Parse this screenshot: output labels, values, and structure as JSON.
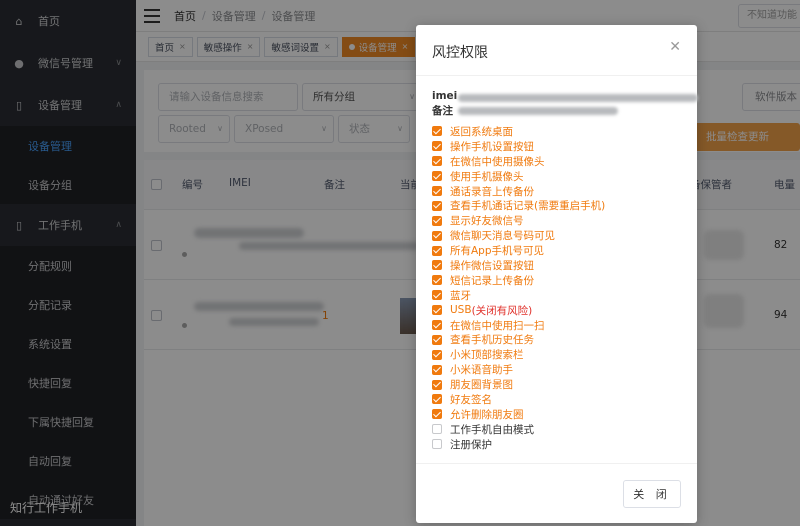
{
  "sidebar": {
    "items": [
      {
        "label": "首页",
        "icon": "home-icon"
      },
      {
        "label": "微信号管理",
        "icon": "wechat-icon"
      },
      {
        "label": "设备管理",
        "icon": "phone-icon"
      },
      {
        "label": "工作手机",
        "icon": "phone-icon"
      }
    ],
    "device_sub": [
      "设备管理",
      "设备分组"
    ],
    "work_sub": [
      "分配规则",
      "分配记录",
      "系统设置",
      "快捷回复",
      "下属快捷回复",
      "自动回复",
      "自动通过好友"
    ],
    "footer": "知行工作手机"
  },
  "topbar": {
    "crumbs": [
      "首页",
      "设备管理",
      "设备管理"
    ],
    "right_box": "不知道功能"
  },
  "tabs": [
    {
      "label": "首页"
    },
    {
      "label": "敏感操作"
    },
    {
      "label": "敏感词设置"
    },
    {
      "label": "设备管理"
    }
  ],
  "filters": {
    "search_placeholder": "请输入设备信息搜索",
    "group_select": "所有分组",
    "rooted": "Rooted",
    "xposed": "XPosed",
    "status": "状态",
    "software_version": "软件版本",
    "batch_button": "批量检查更新"
  },
  "table": {
    "headers": {
      "no": "编号",
      "imei": "IMEI",
      "remark": "备注",
      "current": "当前",
      "keeper": "备保管者",
      "battery": "电量"
    },
    "rows": [
      {
        "battery": "82",
        "remark": ""
      },
      {
        "battery": "94",
        "remark": "1"
      }
    ]
  },
  "modal": {
    "title": "风控权限",
    "imei_label": "imei",
    "remark_label": "备注",
    "permissions": [
      {
        "label": "返回系统桌面",
        "checked": true
      },
      {
        "label": "操作手机设置按钮",
        "checked": true
      },
      {
        "label": "在微信中使用摄像头",
        "checked": true
      },
      {
        "label": "使用手机摄像头",
        "checked": true
      },
      {
        "label": "通话录音上传备份",
        "checked": true
      },
      {
        "label": "查看手机通话记录(需要重启手机)",
        "checked": true
      },
      {
        "label": "显示好友微信号",
        "checked": true
      },
      {
        "label": "微信聊天消息号码可见",
        "checked": true
      },
      {
        "label": "所有App手机号可见",
        "checked": true
      },
      {
        "label": "操作微信设置按钮",
        "checked": true
      },
      {
        "label": "短信记录上传备份",
        "checked": true
      },
      {
        "label": "蓝牙",
        "checked": true
      },
      {
        "label": "USB",
        "suffix": "(关闭有风险)",
        "checked": true
      },
      {
        "label": "在微信中使用扫一扫",
        "checked": true
      },
      {
        "label": "查看手机历史任务",
        "checked": true
      },
      {
        "label": "小米顶部搜索栏",
        "checked": true
      },
      {
        "label": "小米语音助手",
        "checked": true
      },
      {
        "label": "朋友圈背景图",
        "checked": true
      },
      {
        "label": "好友签名",
        "checked": true
      },
      {
        "label": "允许删除朋友圈",
        "checked": true
      },
      {
        "label": "工作手机自由模式",
        "checked": false
      },
      {
        "label": "注册保护",
        "checked": false
      }
    ],
    "close_button": "关 闭"
  },
  "colors": {
    "accent": "#f07a0e",
    "sidebar": "#2a2d33",
    "active_link": "#4aa3ff",
    "warning_text": "#e0302a"
  }
}
